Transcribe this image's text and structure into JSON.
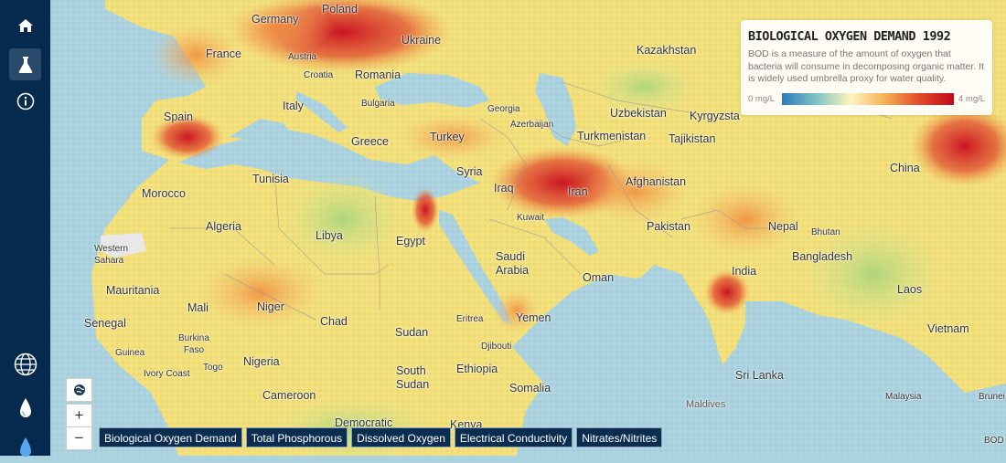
{
  "legend": {
    "title": "BIOLOGICAL OXYGEN DEMAND 1992",
    "description": "BOD is a measure of the amount of oxygen that bacteria will consume in decomposing organic matter. It is widely used umbrella proxy for water quality.",
    "min_label": "0 mg/L",
    "max_label": "4 mg/L",
    "scale_min": 0,
    "scale_max": 4,
    "colors": [
      "#2b7bba",
      "#7fc3c2",
      "#fff5c0",
      "#f5b053",
      "#e04b2a",
      "#c4081e"
    ]
  },
  "tabs": [
    "Biological Oxygen Demand",
    "Total Phosphorous",
    "Dissolved Oxygen",
    "Electrical Conductivity",
    "Nitrates/Nitrites"
  ],
  "sidebar_icons": [
    "home-icon",
    "flask-icon",
    "info-icon",
    "globe-icon",
    "droplet-icon",
    "water-drop-icon"
  ],
  "zoom": {
    "plus": "+",
    "minus": "−"
  },
  "places": {
    "germany": "Germany",
    "poland": "Poland",
    "ukraine": "Ukraine",
    "kazakhstan": "Kazakhstan",
    "france": "France",
    "austria": "Austria",
    "croatia": "Croatia",
    "romania": "Romania",
    "italy": "Italy",
    "bulgaria": "Bulgaria",
    "georgia": "Georgia",
    "azerbaijan": "Azerbaijan",
    "uzbekistan": "Uzbekistan",
    "kyrgyzstan": "Kyrgyzsta",
    "spain": "Spain",
    "greece": "Greece",
    "turkey": "Turkey",
    "turkmenistan": "Turkmenistan",
    "tajikistan": "Tajikistan",
    "tunisia": "Tunisia",
    "syria": "Syria",
    "china": "China",
    "morocco": "Morocco",
    "iraq": "Iraq",
    "iran": "Iran",
    "afghanistan": "Afghanistan",
    "algeria": "Algeria",
    "kuwait": "Kuwait",
    "pakistan": "Pakistan",
    "nepal": "Nepal",
    "bhutan": "Bhutan",
    "libya": "Libya",
    "egypt": "Egypt",
    "western_sahara": "Western\nSahara",
    "saudi_arabia": "Saudi\nArabia",
    "bangladesh": "Bangladesh",
    "oman": "Oman",
    "india": "India",
    "mauritania": "Mauritania",
    "mali": "Mali",
    "niger": "Niger",
    "laos": "Laos",
    "senegal": "Senegal",
    "chad": "Chad",
    "eritrea": "Eritrea",
    "yemen": "Yemen",
    "sudan": "Sudan",
    "vietnam": "Vietnam",
    "burkina_faso": "Burkina\nFaso",
    "guinea": "Guinea",
    "djibouti": "Djibouti",
    "togo": "Togo",
    "ivory_coast": "Ivory Coast",
    "nigeria": "Nigeria",
    "south_sudan": "South\nSudan",
    "ethiopia": "Ethiopia",
    "sri_lanka": "Sri Lanka",
    "somalia": "Somalia",
    "cameroon": "Cameroon",
    "maldives": "Maldives",
    "malaysia": "Malaysia",
    "brunei": "Brunei",
    "democratic": "Democratic",
    "kenya": "Kenya",
    "bod": "BOD"
  }
}
